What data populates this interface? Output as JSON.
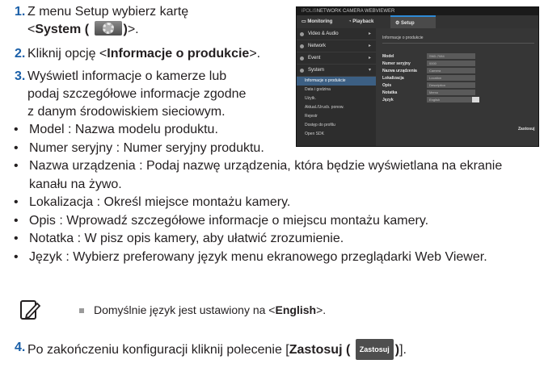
{
  "steps": {
    "s1": {
      "num": "1.",
      "line1": "Z menu Setup wybierz kartę",
      "line2_pre": "<",
      "line2_bold": "System (",
      "line2_bold_post": ")",
      "line2_post": ">."
    },
    "s2": {
      "num": "2.",
      "pre": "Kliknij opcję <",
      "bold": "Informacje o produkcie",
      "post": ">."
    },
    "s3": {
      "num": "3.",
      "line1": "Wyświetl informacje o kamerze lub",
      "line2": "podaj szczegółowe informacje zgodne",
      "line3": "z danym środowiskiem sieciowym."
    },
    "s4": {
      "num": "4.",
      "pre": "Po zakończeniu konfiguracji kliknij polecenie [",
      "bold": "Zastosuj (",
      "button": "Zastosuj",
      "bold_post": ")",
      "post": "]."
    }
  },
  "bullets": [
    "Model : Nazwa modelu produktu.",
    "Numer seryjny : Numer seryjny produktu.",
    "Nazwa urządzenia : Podaj nazwę urządzenia, która będzie wyświetlana na ekranie",
    "kanału na żywo.",
    "Lokalizacja : Określ miejsce montażu kamery.",
    "Opis : Wprowadź szczegółowe informacje o miejscu montażu kamery.",
    "Notatka : W pisz opis kamery, aby ułatwić zrozumienie.",
    "Język : Wybierz preferowany język menu ekranowego przeglądarki Web Viewer."
  ],
  "note": {
    "pre": "Domyślnie język jest ustawiony na <",
    "bold": "English",
    "post": ">.",
    "icon": "note-pencil-icon"
  },
  "screenshot": {
    "title_brand": "iPOLiS",
    "title": "NETWORK CAMERA WEBVIEWER",
    "tabs": [
      "Monitoring",
      "Playback",
      "Setup"
    ],
    "sidebar": [
      "Video & Audio",
      "Network",
      "Event",
      "System"
    ],
    "sidebar_sub": [
      "Informacje o produkcie",
      "Data i godzina",
      "Użytk.",
      "Aktual./Urucb. ponow.",
      "Rejestr",
      "Dostęp do profilu",
      "Open SDK"
    ],
    "panel_title": "Informacje o produkcie",
    "fields": [
      {
        "label": "Model",
        "value": "SND-7084"
      },
      {
        "label": "Numer seryjny",
        "value": "0000"
      },
      {
        "label": "Nazwa urządzenia",
        "value": "Camera"
      },
      {
        "label": "Lokalizacja",
        "value": "Location"
      },
      {
        "label": "Opis",
        "value": "Description"
      },
      {
        "label": "Notatka",
        "value": "Memo"
      },
      {
        "label": "Język",
        "value": "English"
      }
    ],
    "apply": "Zastosuj"
  }
}
